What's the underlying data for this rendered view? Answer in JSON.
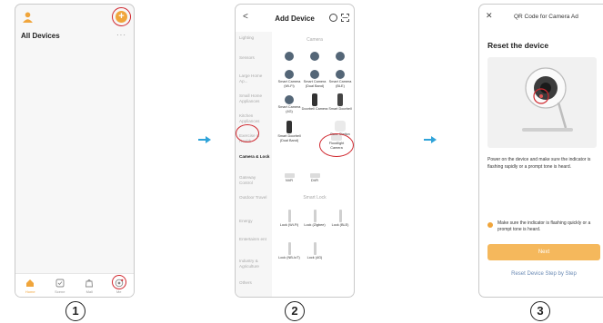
{
  "phone1": {
    "title": "All Devices",
    "more": "···",
    "plus_symbol": "+",
    "tabs": [
      {
        "label": "Home",
        "icon": "home-icon",
        "active": true
      },
      {
        "label": "Scene",
        "icon": "scene-icon",
        "active": false
      },
      {
        "label": "Mall",
        "icon": "mall-icon",
        "active": false
      },
      {
        "label": "Me",
        "icon": "me-icon",
        "active": false
      }
    ]
  },
  "phone2": {
    "back_symbol": "<",
    "title": "Add Device",
    "categories": [
      "Lighting",
      "Sensors",
      "Large Home Ap...",
      "Small Home Appliances",
      "Kitchen Appliances",
      "Exercise & Health",
      "Camera & Lock",
      "Gateway Control",
      "Outdoor Travel",
      "Energy",
      "Entertainm ent",
      "Industry & Agriculture",
      "Others"
    ],
    "sections": {
      "camera": "Camera",
      "smart_lock": "Smart Lock"
    },
    "devices": {
      "row1": [
        "",
        "",
        ""
      ],
      "row2": [
        "Smart Camera (Wi-Fi)",
        "Smart Camera (Dual Band)",
        "Smart Camera (BLE)"
      ],
      "row3": [
        "Smart Camera (4G)",
        "Doorbell Camera",
        "Smart Doorbell"
      ],
      "row4": [
        "Smart Doorbell (Dual Band)",
        "Floodlight Camera",
        "Base Station"
      ],
      "row5": [
        "NVR",
        "DVR"
      ],
      "lock_row1": [
        "Lock (Wi-Fi)",
        "Lock (Zigbee)",
        "Lock (BLE)"
      ],
      "lock_row2": [
        "Lock (NB-IoT)",
        "Lock (4G)"
      ]
    }
  },
  "phone3": {
    "close_symbol": "✕",
    "title": "QR Code for Camera Ad",
    "heading": "Reset the device",
    "description": "Power on the device and make sure the indicator is flashing rapidly or a prompt tone is heard.",
    "confirm": "Make sure the indicator is flashing quickly or a prompt tone is heard.",
    "next": "Next",
    "step_by_step": "Reset Device Step by Step"
  },
  "steps": [
    "1",
    "2",
    "3"
  ],
  "colors": {
    "accent": "#f0a53b",
    "highlight": "#d0282f",
    "arrow": "#2fa3d9",
    "link": "#6a8ab4"
  }
}
